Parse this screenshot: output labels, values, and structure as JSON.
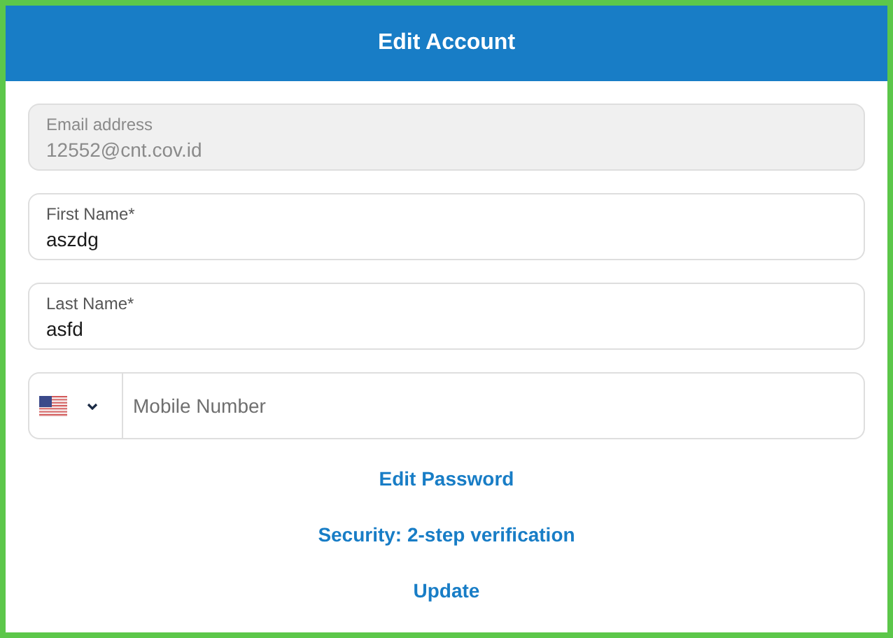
{
  "header": {
    "title": "Edit Account"
  },
  "fields": [
    {
      "label": "Email address",
      "value": "12552@cnt.cov.id",
      "disabled": true
    },
    {
      "label": "First Name*",
      "value": "aszdg",
      "disabled": false
    },
    {
      "label": "Last Name*",
      "value": "asfd",
      "disabled": false
    }
  ],
  "phone": {
    "placeholder": "Mobile Number"
  },
  "links": [
    "Edit Password",
    "Security: 2-step verification",
    "Update"
  ]
}
